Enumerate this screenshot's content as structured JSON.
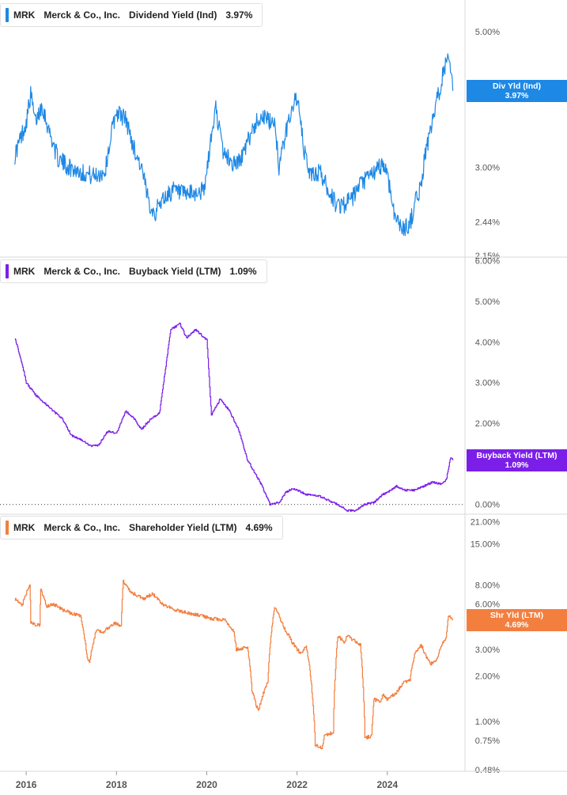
{
  "chart_data": [
    {
      "type": "line",
      "ticker": "MRK",
      "company": "Merck & Co., Inc.",
      "metric": "Dividend Yield (Ind)",
      "current_label": "3.97%",
      "tag": {
        "line1": "Div Yld (Ind)",
        "line2": "3.97%",
        "color": "#1e88e5"
      },
      "color": "#1e88e5",
      "scale": "log",
      "ylim": [
        2.15,
        5.6
      ],
      "ytick_values": [
        5.0,
        3.0,
        2.44,
        2.15
      ],
      "ytick_labels": [
        "5.00%",
        "3.00%",
        "2.44%",
        "2.15%"
      ],
      "x": [
        2015.75,
        2016.0,
        2016.1,
        2016.2,
        2016.35,
        2016.5,
        2016.7,
        2016.95,
        2017.2,
        2017.5,
        2017.75,
        2017.9,
        2018.0,
        2018.2,
        2018.4,
        2018.55,
        2018.7,
        2018.85,
        2019.0,
        2019.25,
        2019.5,
        2019.75,
        2019.95,
        2020.1,
        2020.2,
        2020.35,
        2020.55,
        2020.7,
        2020.85,
        2021.0,
        2021.2,
        2021.4,
        2021.5,
        2021.6,
        2021.75,
        2021.9,
        2022.0,
        2022.15,
        2022.3,
        2022.5,
        2022.7,
        2022.85,
        2023.0,
        2023.2,
        2023.4,
        2023.6,
        2023.75,
        2023.9,
        2024.0,
        2024.1,
        2024.2,
        2024.35,
        2024.5,
        2024.6,
        2024.75,
        2024.85,
        2024.95,
        2025.05,
        2025.15,
        2025.25,
        2025.35,
        2025.45
      ],
      "values": [
        3.14,
        3.55,
        3.95,
        3.55,
        3.8,
        3.45,
        3.1,
        3.0,
        2.95,
        2.9,
        2.95,
        3.45,
        3.7,
        3.6,
        3.2,
        3.0,
        2.65,
        2.52,
        2.65,
        2.75,
        2.7,
        2.72,
        2.75,
        3.35,
        3.75,
        3.2,
        3.05,
        3.05,
        3.2,
        3.45,
        3.65,
        3.55,
        3.6,
        3.0,
        3.4,
        3.8,
        3.9,
        3.2,
        2.9,
        2.95,
        2.75,
        2.62,
        2.6,
        2.65,
        2.8,
        2.9,
        2.95,
        3.05,
        2.92,
        2.65,
        2.45,
        2.38,
        2.42,
        2.6,
        2.8,
        3.2,
        3.4,
        3.7,
        4.0,
        4.35,
        4.5,
        4.0
      ]
    },
    {
      "type": "line",
      "ticker": "MRK",
      "company": "Merck & Co., Inc.",
      "metric": "Buyback Yield (LTM)",
      "current_label": "1.09%",
      "tag": {
        "line1": "Buyback Yield (LTM)",
        "line2": "1.09%",
        "color": "#7b1fe8"
      },
      "color": "#7b1fe8",
      "scale": "linear",
      "ylim": [
        -0.2,
        6.05
      ],
      "ytick_values": [
        6.0,
        5.0,
        4.0,
        3.0,
        2.0,
        0.0
      ],
      "ytick_labels": [
        "6.00%",
        "5.00%",
        "4.00%",
        "3.00%",
        "2.00%",
        "0.00%"
      ],
      "zero_line": true,
      "x": [
        2015.75,
        2015.9,
        2016.0,
        2016.2,
        2016.4,
        2016.6,
        2016.8,
        2017.0,
        2017.2,
        2017.4,
        2017.6,
        2017.8,
        2018.0,
        2018.2,
        2018.4,
        2018.55,
        2018.75,
        2018.95,
        2019.2,
        2019.4,
        2019.55,
        2019.75,
        2020.0,
        2020.1,
        2020.3,
        2020.5,
        2020.7,
        2020.9,
        2021.0,
        2021.2,
        2021.4,
        2021.6,
        2021.75,
        2021.9,
        2022.2,
        2022.5,
        2022.7,
        2022.9,
        2023.1,
        2023.3,
        2023.5,
        2023.7,
        2023.9,
        2024.0,
        2024.2,
        2024.4,
        2024.6,
        2024.8,
        2025.0,
        2025.2,
        2025.3,
        2025.4,
        2025.45
      ],
      "values": [
        4.1,
        3.5,
        3.0,
        2.7,
        2.5,
        2.3,
        2.1,
        1.7,
        1.6,
        1.45,
        1.45,
        1.8,
        1.75,
        2.3,
        2.1,
        1.85,
        2.1,
        2.25,
        4.3,
        4.45,
        4.1,
        4.3,
        4.05,
        2.2,
        2.6,
        2.3,
        1.85,
        1.1,
        0.9,
        0.5,
        0.0,
        0.05,
        0.3,
        0.4,
        0.25,
        0.2,
        0.1,
        0.0,
        -0.15,
        -0.15,
        0.0,
        0.05,
        0.25,
        0.3,
        0.45,
        0.35,
        0.35,
        0.45,
        0.55,
        0.5,
        0.6,
        1.15,
        1.09
      ]
    },
    {
      "type": "line",
      "ticker": "MRK",
      "company": "Merck & Co., Inc.",
      "metric": "Shareholder Yield (LTM)",
      "current_label": "4.69%",
      "tag": {
        "line1": "Shr Yld (LTM)",
        "line2": "4.69%",
        "color": "#f37f3f"
      },
      "color": "#f37f3f",
      "scale": "log",
      "ylim": [
        0.48,
        23.0
      ],
      "ytick_values": [
        21.0,
        15.0,
        8.0,
        6.0,
        3.0,
        2.0,
        1.0,
        0.75,
        0.48
      ],
      "ytick_labels": [
        "21.00%",
        "15.00%",
        "8.00%",
        "6.00%",
        "3.00%",
        "2.00%",
        "1.00%",
        "0.75%",
        "0.48%"
      ],
      "x": [
        2015.75,
        2015.9,
        2016.0,
        2016.08,
        2016.1,
        2016.3,
        2016.32,
        2016.45,
        2016.6,
        2016.8,
        2017.0,
        2017.2,
        2017.35,
        2017.4,
        2017.55,
        2017.7,
        2017.95,
        2018.1,
        2018.15,
        2018.3,
        2018.6,
        2018.8,
        2019.0,
        2019.3,
        2019.6,
        2019.9,
        2020.1,
        2020.4,
        2020.6,
        2020.65,
        2020.9,
        2021.0,
        2021.1,
        2021.15,
        2021.3,
        2021.35,
        2021.5,
        2021.55,
        2021.7,
        2021.9,
        2022.0,
        2022.1,
        2022.2,
        2022.4,
        2022.55,
        2022.6,
        2022.8,
        2022.9,
        2023.05,
        2023.1,
        2023.4,
        2023.5,
        2023.65,
        2023.7,
        2023.85,
        2023.9,
        2024.0,
        2024.2,
        2024.35,
        2024.5,
        2024.6,
        2024.75,
        2024.85,
        2024.95,
        2025.1,
        2025.2,
        2025.3,
        2025.35,
        2025.45
      ],
      "values": [
        6.5,
        5.8,
        7.0,
        8.2,
        4.5,
        4.3,
        7.5,
        5.8,
        6.0,
        5.5,
        5.2,
        5.0,
        2.6,
        2.5,
        4.0,
        3.9,
        4.5,
        4.3,
        8.5,
        7.2,
        6.5,
        7.0,
        6.0,
        5.5,
        5.2,
        5.0,
        4.8,
        4.7,
        3.9,
        3.0,
        3.1,
        1.6,
        1.25,
        1.2,
        1.7,
        1.8,
        5.8,
        5.4,
        4.2,
        3.3,
        3.0,
        2.8,
        3.2,
        0.7,
        0.66,
        0.8,
        0.85,
        3.7,
        3.3,
        3.7,
        3.2,
        0.78,
        0.8,
        1.4,
        1.35,
        1.5,
        1.4,
        1.55,
        1.8,
        1.9,
        2.8,
        3.2,
        2.7,
        2.4,
        2.6,
        3.2,
        3.6,
        5.0,
        4.69
      ]
    }
  ],
  "x_axis": {
    "ticks": [
      2016,
      2018,
      2020,
      2022,
      2024
    ],
    "labels": [
      "2016",
      "2018",
      "2020",
      "2022",
      "2024"
    ],
    "xlim": [
      2015.42,
      2025.72
    ]
  },
  "colors": {
    "grid": "#d9d9d9",
    "axis_text": "#555555",
    "zero_line": "#333333"
  }
}
